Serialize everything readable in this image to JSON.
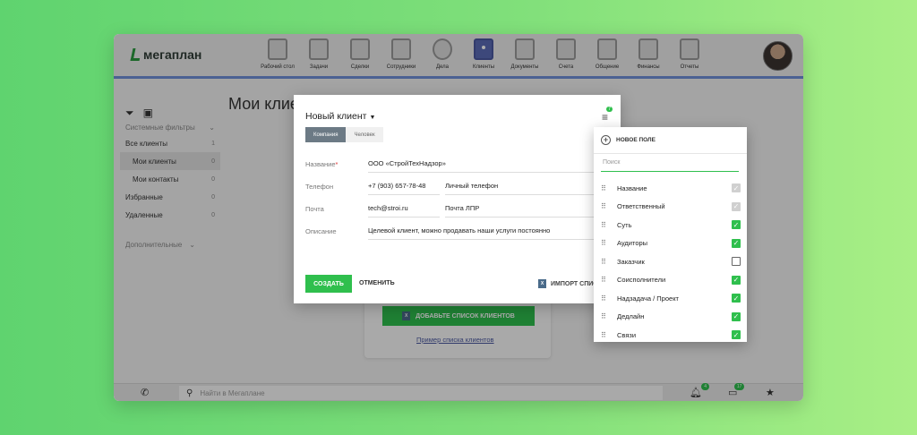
{
  "app": {
    "logo": "мегаплан"
  },
  "nav": [
    {
      "label": "Рабочий стол",
      "icon": "desktop-icon"
    },
    {
      "label": "Задачи",
      "icon": "tasks-icon"
    },
    {
      "label": "Сделки",
      "icon": "briefcase-icon"
    },
    {
      "label": "Сотрудники",
      "icon": "people-icon"
    },
    {
      "label": "Дела",
      "icon": "clock-icon"
    },
    {
      "label": "Клиенты",
      "icon": "clients-icon"
    },
    {
      "label": "Документы",
      "icon": "folder-icon"
    },
    {
      "label": "Счета",
      "icon": "invoice-icon"
    },
    {
      "label": "Общение",
      "icon": "chat-icon"
    },
    {
      "label": "Финансы",
      "icon": "safe-icon"
    },
    {
      "label": "Отчеты",
      "icon": "reports-icon"
    }
  ],
  "nav_active": "Клиенты",
  "sidebar": {
    "system_filters": "Системные фильтры",
    "items": [
      {
        "label": "Все клиенты",
        "count": "1"
      },
      {
        "label": "Мои клиенты",
        "count": "0"
      },
      {
        "label": "Мои контакты",
        "count": "0"
      },
      {
        "label": "Избранные",
        "count": "0"
      },
      {
        "label": "Удаленные",
        "count": "0"
      }
    ],
    "additional": "Дополнительные"
  },
  "main": {
    "title": "Мои клиенты",
    "add_list_button": "ДОБАВЬТЕ СПИСОК КЛИЕНТОВ",
    "example_link": "Пример списка клиентов"
  },
  "bottom": {
    "search_placeholder": "Найти в Мегаплане",
    "notif_count": "4",
    "chat_count": "17"
  },
  "modal": {
    "title": "Новый клиент",
    "fields_badge": "7",
    "tabs": [
      "Компания",
      "Человек"
    ],
    "active_tab": "Компания",
    "fields": {
      "name_label": "Название",
      "name_value": "ООО «СтройТехНадзор»",
      "phone_label": "Телефон",
      "phone_value": "+7 (903) 657-78-48",
      "phone_type": "Личный телефон",
      "email_label": "Почта",
      "email_value": "tech@stroi.ru",
      "email_type": "Почта ЛПР",
      "desc_label": "Описание",
      "desc_value": "Целевой клиент, можно продавать наши услуги постоянно"
    },
    "create": "СОЗДАТЬ",
    "cancel": "ОТМЕНИТЬ",
    "import": "ИМПОРТ СПИСКА"
  },
  "panel": {
    "new_field": "НОВОЕ ПОЛЕ",
    "search_placeholder": "Поиск",
    "items": [
      {
        "label": "Название",
        "state": "disabled"
      },
      {
        "label": "Ответственный",
        "state": "disabled"
      },
      {
        "label": "Суть",
        "state": "checked"
      },
      {
        "label": "Аудиторы",
        "state": "checked"
      },
      {
        "label": "Заказчик",
        "state": "unchecked"
      },
      {
        "label": "Соисполнители",
        "state": "checked"
      },
      {
        "label": "Надзадача / Проект",
        "state": "checked"
      },
      {
        "label": "Дедлайн",
        "state": "checked"
      },
      {
        "label": "Связи",
        "state": "checked"
      }
    ]
  },
  "colors": {
    "accent": "#2fbf4d",
    "nav_underline": "#6f8fd9",
    "active_icon": "#5b6bb5"
  }
}
